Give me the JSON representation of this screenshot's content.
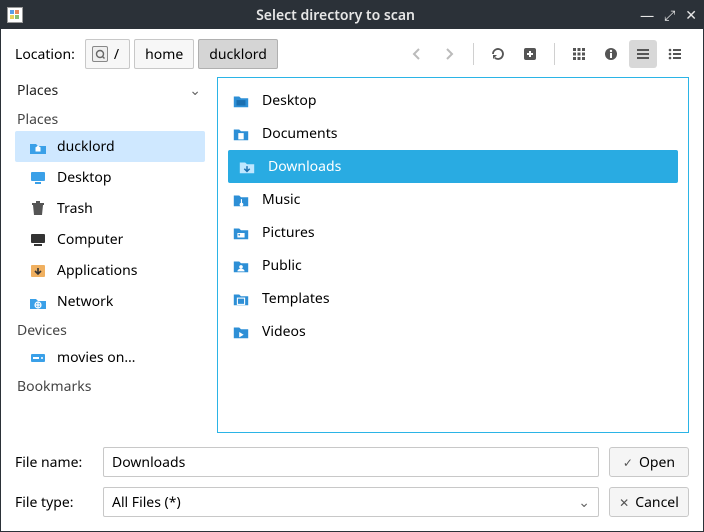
{
  "window": {
    "title": "Select directory to scan"
  },
  "toolbar": {
    "location_label": "Location:",
    "path": {
      "root_sep": "/",
      "seg_home": "home",
      "seg_current": "ducklord"
    }
  },
  "sidebar": {
    "header": "Places",
    "groups": {
      "places": {
        "label": "Places",
        "items": [
          {
            "label": "ducklord",
            "icon": "home-folder",
            "selected": true
          },
          {
            "label": "Desktop",
            "icon": "desktop"
          },
          {
            "label": "Trash",
            "icon": "trash"
          },
          {
            "label": "Computer",
            "icon": "computer"
          },
          {
            "label": "Applications",
            "icon": "apps"
          },
          {
            "label": "Network",
            "icon": "network"
          }
        ]
      },
      "devices": {
        "label": "Devices",
        "items": [
          {
            "label": "movies on…",
            "icon": "drive"
          }
        ]
      },
      "bookmarks": {
        "label": "Bookmarks",
        "items": []
      }
    }
  },
  "files": [
    {
      "label": "Desktop",
      "selected": false
    },
    {
      "label": "Documents",
      "selected": false
    },
    {
      "label": "Downloads",
      "selected": true
    },
    {
      "label": "Music",
      "selected": false
    },
    {
      "label": "Pictures",
      "selected": false
    },
    {
      "label": "Public",
      "selected": false
    },
    {
      "label": "Templates",
      "selected": false
    },
    {
      "label": "Videos",
      "selected": false
    }
  ],
  "bottom": {
    "name_label": "File name:",
    "name_value": "Downloads",
    "type_label": "File type:",
    "type_value": "All Files (*)",
    "open": "Open",
    "cancel": "Cancel"
  }
}
